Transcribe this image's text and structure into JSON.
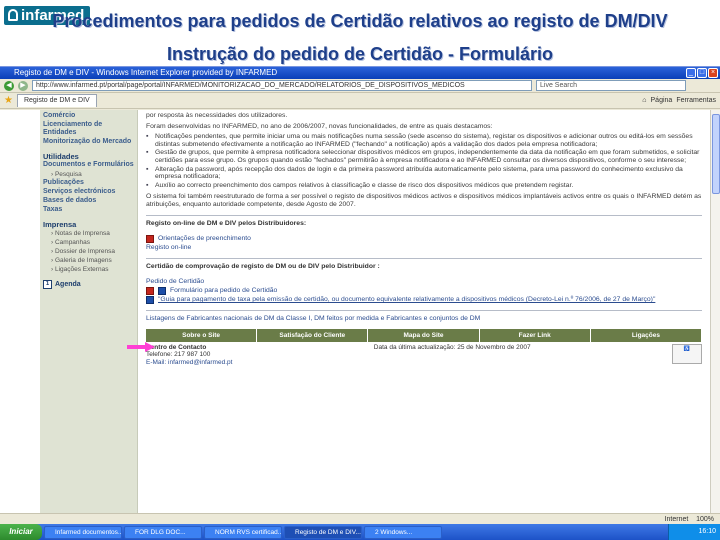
{
  "slide": {
    "logo": "infarmed",
    "title_line1": "Procedimentos para pedidos de Certidão relativos ao registo de DM/DIV",
    "title_line2": "Instrução do pedido de Certidão - Formulário"
  },
  "browser": {
    "window_title": "Registo de DM e DIV - Windows Internet Explorer provided by INFARMED",
    "url": "http://www.infarmed.pt/portal/page/portal/INFARMED/MONITORIZACAO_DO_MERCADO/RELATORIOS_DE_DISPOSITIVOS_MEDICOS",
    "search_placeholder": "Live Search",
    "tab_label": "Registo de DM e DIV",
    "toolbar_page": "Página",
    "toolbar_tools": "Ferramentas",
    "status_internet": "Internet",
    "status_zoom": "100%"
  },
  "sidebar": {
    "items": [
      {
        "label": "Comércio"
      },
      {
        "label": "Licenciamento de Entidades"
      },
      {
        "label": "Monitorização do Mercado"
      }
    ],
    "heading1": "Utilidades",
    "group1": [
      {
        "label": "Documentos e Formulários"
      },
      {
        "label": "› Pesquisa"
      },
      {
        "label": "Publicações"
      },
      {
        "label": "Serviços electrónicos"
      },
      {
        "label": "Bases de dados"
      },
      {
        "label": "Taxas"
      }
    ],
    "heading2": "Imprensa",
    "group2": [
      {
        "label": "› Notas de Imprensa"
      },
      {
        "label": "› Campanhas"
      },
      {
        "label": "› Dossier de Imprensa"
      },
      {
        "label": "› Galeria de Imagens"
      },
      {
        "label": "› Ligações Externas"
      }
    ],
    "agenda": "Agenda"
  },
  "main": {
    "intro": "por resposta às necessidades dos utilizadores.",
    "para1": "Foram desenvolvidas no INFARMED, no ano de 2006/2007, novas funcionalidades, de entre as quais destacamos:",
    "bullets": [
      "Notificações pendentes, que permite iniciar uma ou mais notificações numa sessão (sede ascenso do sistema), registar os dispositivos e adicionar outros ou editá-los em sessões distintas submetendo efectivamente a notificação ao INFARMED (\"fechando\" a notificação) após a validação dos dados pela empresa notificadora;",
      "Gestão de grupos, que permite à empresa notificadora seleccionar dispositivos médicos em grupos, independentemente da data da notificação em que foram submetidos, e solicitar certidões para esse grupo. Os grupos quando estão \"fechados\" permitirão à empresa notificadora e ao INFARMED consultar os diversos dispositivos, conforme o seu interesse;",
      "Alteração da password, após recepção dos dados de login e da primeira password atribuída automaticamente pelo sistema, para uma password do conhecimento exclusivo da empresa notificadora;",
      "Auxílio ao correcto preenchimento dos campos relativos à classificação e classe de risco dos dispositivos médicos que pretendem registar."
    ],
    "para2": "O sistema foi também reestruturado de forma a ser possível o registo de dispositivos médicos activos e dispositivos médicos implantáveis activos entre os quais o INFARMED detém as atribuições, enquanto autoridade competente, desde Agosto de 2007.",
    "sec1_title": "Registo on-line de DM e DIV pelos Distribuidores:",
    "sec1_link1": "Orientações de preenchimento",
    "sec1_link2": "Registo on-line",
    "sec2_title": "Certidão de comprovação de registo de DM ou de DIV pelo Distribuidor :",
    "sec2_link1": "Pedido de Certidão",
    "sec2_link2": "Formulário para pedido de Certidão",
    "sec2_link3": "\"Guia para pagamento de taxa pela emissão de certidão, ou documento equivalente relativamente a dispositivos médicos (Decreto-Lei n.º 76/2006, de 27 de Março)\"",
    "listings": "Listagens de Fabricantes nacionais de DM da Classe I, DM feitos por medida e Fabricantes e conjuntos de DM",
    "footer_nav": [
      "Sobre o Site",
      "Satisfação do Cliente",
      "Mapa do Site",
      "Fazer Link",
      "Ligações"
    ],
    "footer_contact_label": "Centro de Contacto",
    "footer_phone": "Telefone: 217 987 100",
    "footer_email": "E-Mail: infarmed@infarmed.pt",
    "footer_updated": "Data da última actualização: 25 de Novembro de 2007"
  },
  "taskbar": {
    "start": "Iniciar",
    "tasks": [
      "Infarmed documentos...",
      "FOR DLG DOC...",
      "NORM RVS certificad...",
      "Registo de DM e DIV...",
      "2 Windows..."
    ],
    "clock": "16:10"
  }
}
